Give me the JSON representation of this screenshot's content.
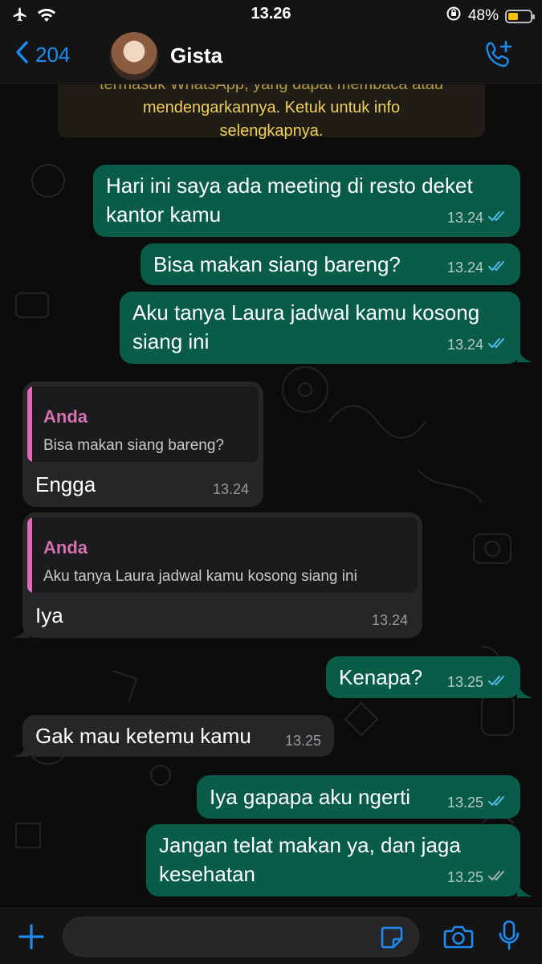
{
  "status_bar": {
    "time": "13.26",
    "battery_percent": "48%",
    "battery_level": 0.48
  },
  "header": {
    "back_count": "204",
    "contact_name": "Gista"
  },
  "notice": {
    "line0": "termasuk WhatsApp, yang dapat membaca atau",
    "line1": "mendengarkannya. Ketuk untuk info",
    "line2": "selengkapnya."
  },
  "messages": [
    {
      "text1": "Hari ini saya ada meeting di resto deket",
      "text2": "kantor kamu",
      "time": "13.24"
    },
    {
      "text1": "Bisa makan siang bareng?",
      "time": "13.24"
    },
    {
      "text1": "Aku tanya Laura jadwal kamu kosong",
      "text2": "siang ini",
      "time": "13.24"
    },
    {
      "quote_author": "Anda",
      "quote_text": "Bisa makan siang bareng?",
      "text1": "Engga",
      "time": "13.24"
    },
    {
      "quote_author": "Anda",
      "quote_text": "Aku tanya Laura jadwal kamu kosong siang ini",
      "text1": "Iya",
      "time": "13.24"
    },
    {
      "text1": "Kenapa?",
      "time": "13.25"
    },
    {
      "text1": "Gak mau ketemu kamu",
      "time": "13.25"
    },
    {
      "text1": "Iya gapapa aku ngerti",
      "time": "13.25"
    },
    {
      "text1": "Jangan telat makan ya, dan jaga",
      "text2": "kesehatan",
      "time": "13.25"
    }
  ],
  "colors": {
    "accent": "#1e8bf0",
    "outgoing": "#085c48",
    "incoming": "#262628",
    "read_tick": "#53bdeb",
    "sent_tick": "#9fb3ad"
  }
}
